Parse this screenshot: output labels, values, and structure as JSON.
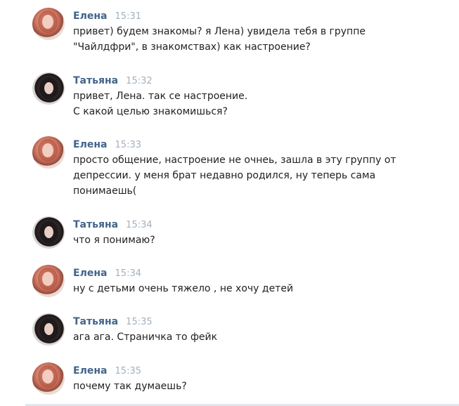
{
  "messages": [
    {
      "author": "Елена",
      "time": "15:31",
      "avatar": "elena-avatar",
      "lines": [
        "привет) будем знакомы? я Лена) увидела тебя в группе",
        "\"Чайлдфри\", в знакомствах) как настроение?"
      ]
    },
    {
      "author": "Татьяна",
      "time": "15:32",
      "avatar": "tatyana-avatar",
      "lines": [
        "привет, Лена. так се настроение.",
        "С какой целью знакомишься?"
      ]
    },
    {
      "author": "Елена",
      "time": "15:33",
      "avatar": "elena-avatar",
      "lines": [
        "просто общение, настроение не очнеь, зашла в эту группу от",
        "депрессии. у меня брат недавно родился, ну теперь сама",
        "понимаешь("
      ]
    },
    {
      "author": "Татьяна",
      "time": "15:34",
      "avatar": "tatyana-avatar",
      "lines": [
        "что я понимаю?"
      ]
    },
    {
      "author": "Елена",
      "time": "15:34",
      "avatar": "elena-avatar",
      "lines": [
        "ну с детьми очень тяжело , не хочу детей"
      ]
    },
    {
      "author": "Татьяна",
      "time": "15:35",
      "avatar": "tatyana-avatar",
      "lines": [
        "ага ага. Страничка то фейк"
      ]
    },
    {
      "author": "Елена",
      "time": "15:35",
      "avatar": "elena-avatar",
      "lines": [
        "почему так думаешь?"
      ]
    }
  ],
  "colors": {
    "author_name": "#42648b",
    "time": "#a3b0be",
    "text": "#1f1f1f"
  }
}
